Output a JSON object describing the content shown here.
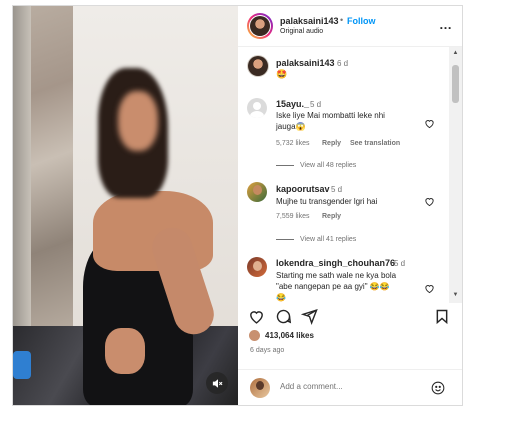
{
  "header": {
    "username": "palaksaini143",
    "dot": "•",
    "follow_label": "Follow",
    "audio": "Original audio",
    "more": "…"
  },
  "caption": {
    "username": "palaksaini143",
    "time": "6 d",
    "emoji": "🤩"
  },
  "comments": [
    {
      "username": "15ayu._",
      "time": "5 d",
      "text_line1": "Iske liye Mai mombatti leke nhi",
      "text_line2": "jauga😱",
      "likes": "5,732 likes",
      "reply": "Reply",
      "translate": "See translation",
      "view_replies": "View all 48 replies"
    },
    {
      "username": "kapoorutsav",
      "time": "5 d",
      "text_line1": "Mujhe tu transgender lgri hai",
      "likes": "7,559 likes",
      "reply": "Reply",
      "view_replies": "View all 41 replies"
    },
    {
      "username": "lokendra_singh_chouhan76",
      "time": "5 d",
      "text_line1": "Starting me sath wale ne kya bola",
      "text_line2": "\"abe nangepan pe aa gyi\" 😂😂",
      "text_line3": "😂"
    }
  ],
  "post": {
    "likes": "413,064 likes",
    "date": "6 days ago"
  },
  "add_comment": {
    "placeholder": "Add a comment..."
  },
  "icons": {
    "heart": "heart-icon",
    "comment": "comment-icon",
    "share": "share-icon",
    "save": "bookmark-icon",
    "emoji": "emoji-icon",
    "mute": "mute-icon"
  },
  "colors": {
    "follow": "#0095f6",
    "border": "#dbdbdb",
    "muted": "#737373"
  }
}
